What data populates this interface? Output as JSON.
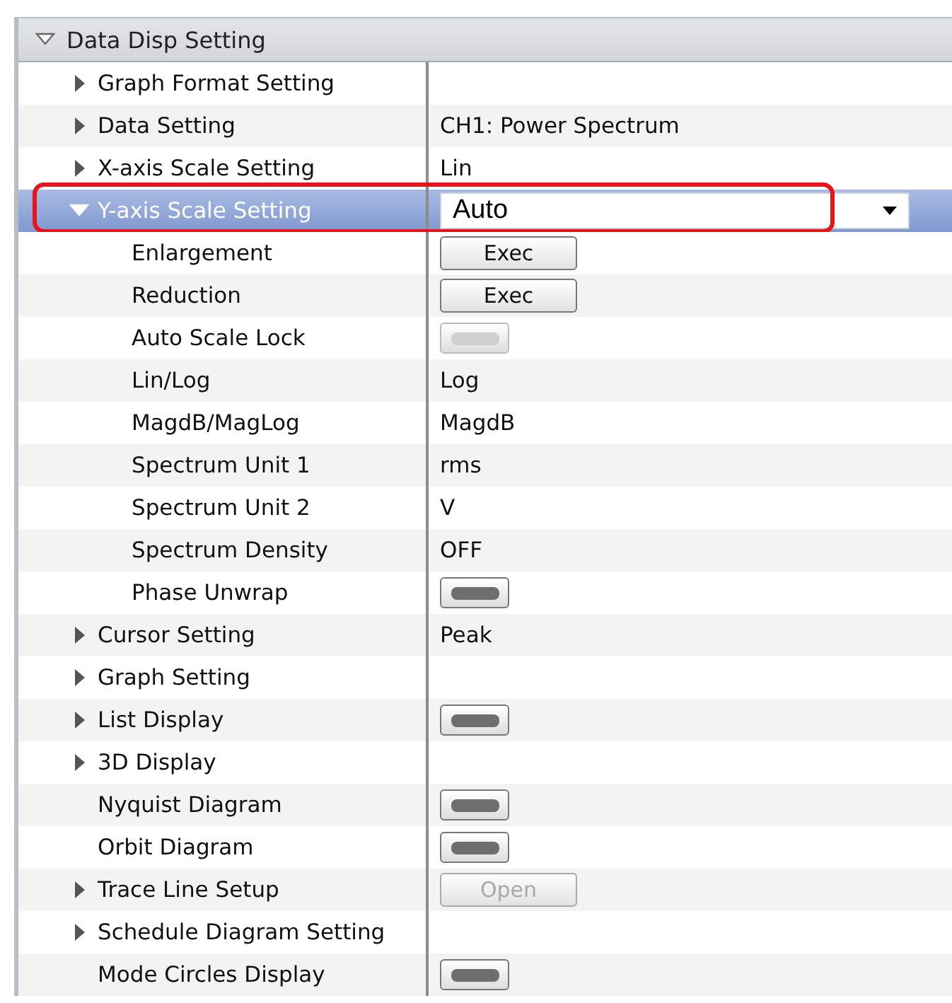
{
  "tree": {
    "label": "Data Disp Setting",
    "expanded": true,
    "children": [
      {
        "label": "Graph Format Setting",
        "expanded": false,
        "selected": false
      },
      {
        "label": "Data Setting",
        "expanded": false,
        "selected": false,
        "value": {
          "kind": "text",
          "text": "CH1: Power Spectrum"
        }
      },
      {
        "label": "X-axis Scale Setting",
        "expanded": false,
        "selected": false,
        "value": {
          "kind": "text",
          "text": "Lin"
        }
      },
      {
        "label": "Y-axis Scale Setting",
        "expanded": true,
        "selected": true,
        "highlighted": true,
        "value": {
          "kind": "dropdown",
          "text": "Auto"
        },
        "children": [
          {
            "label": "Enlargement",
            "selected": false,
            "value": {
              "kind": "button",
              "label": "Exec",
              "disabled": false
            }
          },
          {
            "label": "Reduction",
            "selected": false,
            "value": {
              "kind": "button",
              "label": "Exec",
              "disabled": false
            }
          },
          {
            "label": "Auto Scale Lock",
            "selected": false,
            "value": {
              "kind": "toggle",
              "disabled": true
            }
          },
          {
            "label": "Lin/Log",
            "selected": false,
            "value": {
              "kind": "text",
              "text": "Log"
            }
          },
          {
            "label": "MagdB/MagLog",
            "selected": false,
            "value": {
              "kind": "text",
              "text": "MagdB"
            }
          },
          {
            "label": "Spectrum Unit 1",
            "selected": false,
            "value": {
              "kind": "text",
              "text": "rms"
            }
          },
          {
            "label": "Spectrum Unit 2",
            "selected": false,
            "value": {
              "kind": "text",
              "text": "V"
            }
          },
          {
            "label": "Spectrum Density",
            "selected": false,
            "value": {
              "kind": "text",
              "text": "OFF"
            }
          },
          {
            "label": "Phase Unwrap",
            "selected": false,
            "value": {
              "kind": "toggle",
              "disabled": false
            }
          }
        ]
      },
      {
        "label": "Cursor Setting",
        "expanded": false,
        "selected": false,
        "value": {
          "kind": "text",
          "text": "Peak"
        }
      },
      {
        "label": "Graph Setting",
        "expanded": false,
        "selected": false
      },
      {
        "label": "List Display",
        "expanded": false,
        "selected": false,
        "value": {
          "kind": "toggle",
          "disabled": false
        }
      },
      {
        "label": "3D Display",
        "expanded": false,
        "selected": false
      },
      {
        "label": "Nyquist Diagram",
        "selected": false,
        "value": {
          "kind": "toggle",
          "disabled": false
        }
      },
      {
        "label": "Orbit Diagram",
        "selected": false,
        "value": {
          "kind": "toggle",
          "disabled": false
        }
      },
      {
        "label": "Trace Line Setup",
        "expanded": false,
        "selected": false,
        "value": {
          "kind": "button",
          "label": "Open",
          "disabled": true
        }
      },
      {
        "label": "Schedule Diagram Setting",
        "expanded": false,
        "selected": false
      },
      {
        "label": "Mode Circles Display",
        "selected": false,
        "value": {
          "kind": "toggle",
          "disabled": false
        }
      }
    ]
  }
}
